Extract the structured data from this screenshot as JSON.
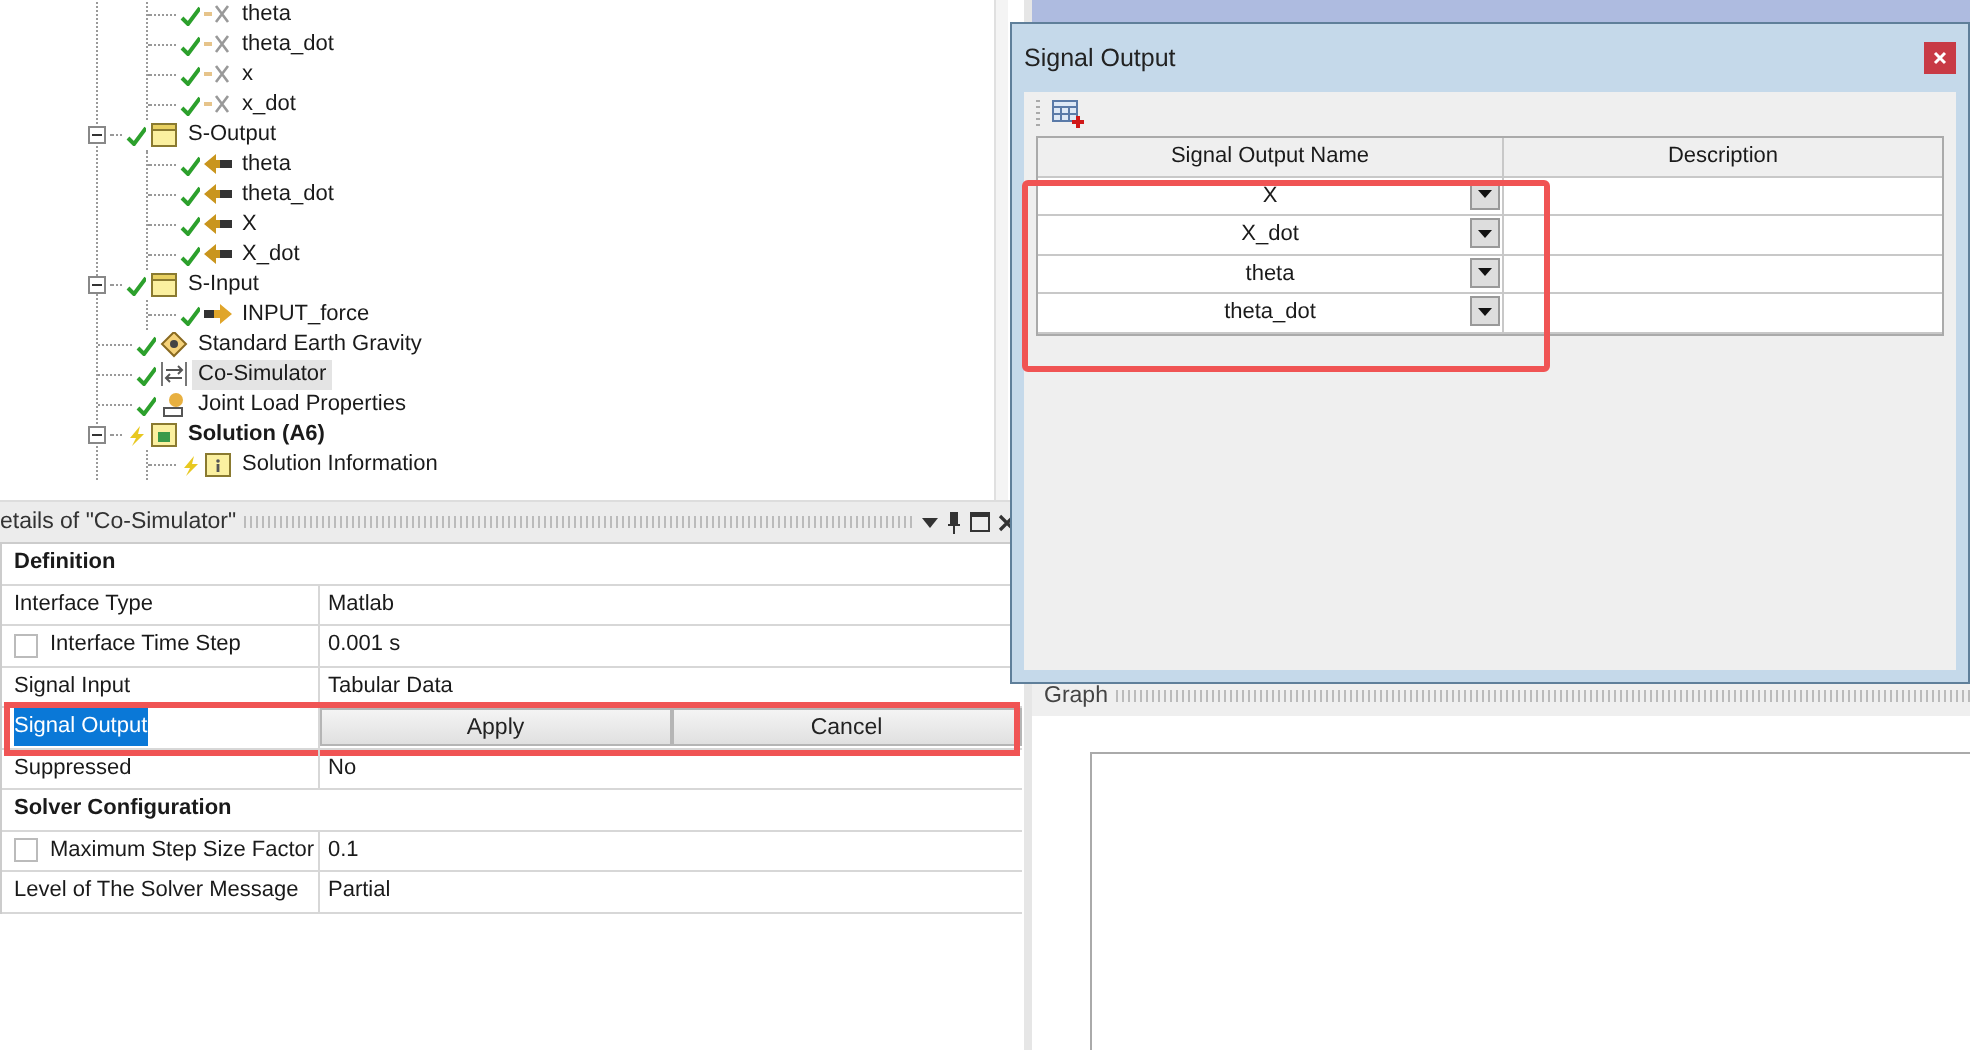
{
  "tree": {
    "cut_children": [
      {
        "label": "theta",
        "kind": "variable",
        "solved": true,
        "selected": false
      },
      {
        "label": "theta_dot",
        "kind": "variable",
        "solved": true,
        "selected": false
      },
      {
        "label": "x",
        "kind": "variable",
        "solved": true,
        "selected": false
      },
      {
        "label": "x_dot",
        "kind": "variable",
        "solved": true,
        "selected": false
      }
    ],
    "items": [
      {
        "label": "S-Output",
        "kind": "folder",
        "solved": true,
        "expanded": true,
        "selected": false,
        "children": [
          {
            "label": "theta",
            "kind": "output",
            "solved": true,
            "selected": false
          },
          {
            "label": "theta_dot",
            "kind": "output",
            "solved": true,
            "selected": false
          },
          {
            "label": "X",
            "kind": "output",
            "solved": true,
            "selected": false
          },
          {
            "label": "X_dot",
            "kind": "output",
            "solved": true,
            "selected": false
          }
        ]
      },
      {
        "label": "S-Input",
        "kind": "folder",
        "solved": true,
        "expanded": true,
        "selected": false,
        "children": [
          {
            "label": "INPUT_force",
            "kind": "input",
            "solved": true,
            "selected": false
          }
        ]
      },
      {
        "label": "Standard Earth Gravity",
        "kind": "gravity",
        "solved": true,
        "selected": false
      },
      {
        "label": "Co-Simulator",
        "kind": "cosim",
        "solved": true,
        "selected": true
      },
      {
        "label": "Joint Load Properties",
        "kind": "joint",
        "solved": true,
        "selected": false
      },
      {
        "label": "Solution (A6)",
        "kind": "solution",
        "solved": false,
        "expanded": true,
        "selected": false,
        "children": [
          {
            "label": "Solution Information",
            "kind": "info",
            "solved": false,
            "selected": false
          }
        ]
      }
    ]
  },
  "details": {
    "title": "etails of \"Co-Simulator\"",
    "rows": [
      {
        "kind": "section",
        "label": "Definition"
      },
      {
        "kind": "property",
        "label": "Interface Type",
        "value": "Matlab",
        "selected": false
      },
      {
        "kind": "property",
        "label": "Interface Time Step",
        "checked": false,
        "value": "0.001 s",
        "selected": false
      },
      {
        "kind": "property",
        "label": "Signal Input",
        "value": "Tabular Data",
        "selected": false
      },
      {
        "kind": "property",
        "label": "Signal Output",
        "buttons": [
          "Apply",
          "Cancel"
        ],
        "selected": true,
        "highlighted": true
      },
      {
        "kind": "property",
        "label": "Suppressed",
        "value": "No",
        "selected": false
      },
      {
        "kind": "section",
        "label": "Solver Configuration"
      },
      {
        "kind": "property",
        "label": "Maximum Step Size Factor",
        "checked": false,
        "value": "0.1",
        "selected": false
      },
      {
        "kind": "property",
        "label": "Level of The Solver Message",
        "value": "Partial",
        "selected": false
      }
    ]
  },
  "dialog": {
    "title": "Signal Output",
    "columns": [
      "Signal Output Name",
      "Description"
    ],
    "highlighted": true,
    "rows": [
      {
        "name": "X"
      },
      {
        "name": "X_dot"
      },
      {
        "name": "theta"
      },
      {
        "name": "theta_dot"
      }
    ]
  },
  "graph": {
    "title": "Graph"
  }
}
